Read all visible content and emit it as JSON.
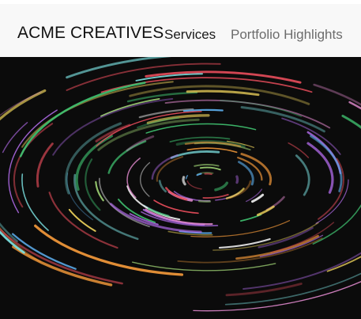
{
  "navbar": {
    "brand": "ACME CREATIVES",
    "links": [
      {
        "label": "Services",
        "active": true
      },
      {
        "label": "Portfolio Highlights",
        "active": false
      }
    ]
  },
  "hero": {
    "description_icon": "light-trails-swirl",
    "background_color": "#0b0b0b",
    "palette": [
      "#e84d5b",
      "#f2d65c",
      "#3fbf6f",
      "#5aa9e6",
      "#b06be8",
      "#ffffff",
      "#e48bd0",
      "#7be0e0",
      "#f59a3a",
      "#a3d977"
    ]
  }
}
